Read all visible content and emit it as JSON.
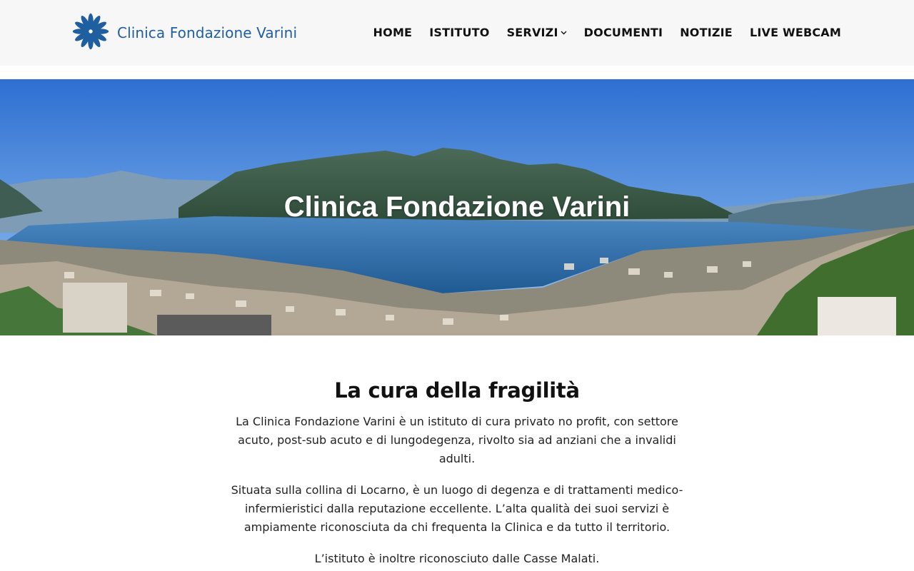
{
  "brand": {
    "name": "Clinica Fondazione Varini",
    "color": "#1f5fa0",
    "logo_icon": "flower-icon"
  },
  "nav": {
    "items": [
      {
        "label": "HOME"
      },
      {
        "label": "ISTITUTO"
      },
      {
        "label": "SERVIZI",
        "icon": "chevron-down-icon"
      },
      {
        "label": "DOCUMENTI"
      },
      {
        "label": "NOTIZIE"
      },
      {
        "label": "LIVE WEBCAM"
      }
    ]
  },
  "hero": {
    "title": "Clinica Fondazione Varini",
    "image": "panorama of Lago Maggiore and Locarno"
  },
  "content": {
    "heading": "La cura della fragilità",
    "paragraphs": [
      "La Clinica Fondazione Varini è un istituto di cura privato no profit, con settore acuto, post-sub acuto e di lungodegenza, rivolto sia ad anziani che a invalidi adulti.",
      "Situata sulla collina di Locarno, è un luogo di degenza e di trattamenti medico-infermieristici dalla reputazione eccellente. L’alta qualità dei suoi servizi è ampiamente riconosciuta da chi frequenta la Clinica e da tutto il territorio.",
      "L’istituto è inoltre riconosciuto dalle Casse Malati."
    ]
  }
}
